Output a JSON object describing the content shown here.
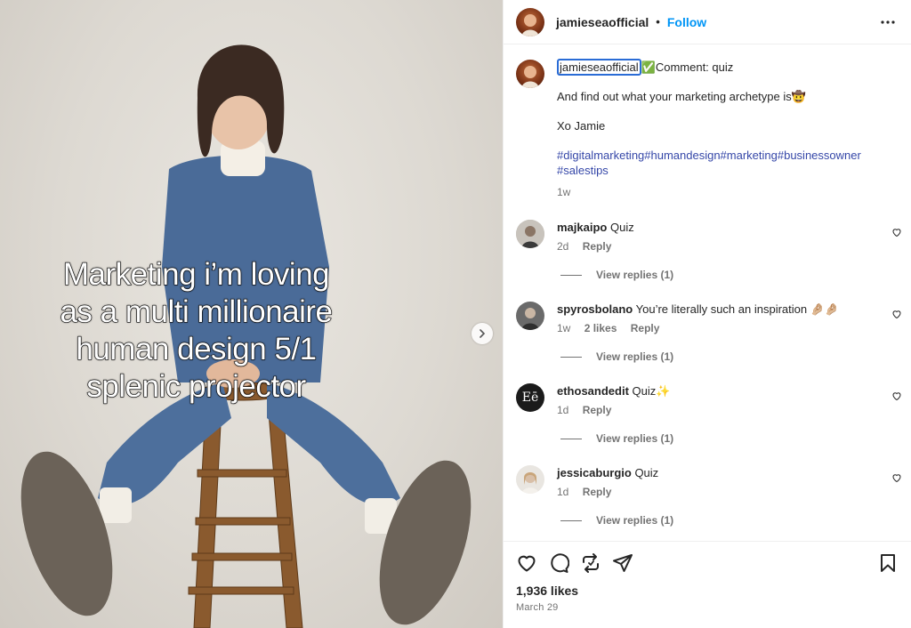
{
  "post": {
    "caption_overlay": [
      "Marketing i’m loving",
      "as a multi millionaire",
      "human design 5/1",
      "splenic projector"
    ]
  },
  "header": {
    "username": "jamieseaofficial",
    "separator": "•",
    "follow_label": "Follow",
    "more_icon": "more-horizontal-icon"
  },
  "caption": {
    "username": "jamieseaofficial",
    "check": "✅",
    "first_line": "Comment: quiz",
    "line2": "And find out what your marketing archetype is🤠",
    "line3": "Xo Jamie",
    "tags_line1": "#digitalmarketing#humandesign#marketing#businessowner",
    "tags_line2": "#salestips",
    "time": "1w"
  },
  "comments": [
    {
      "username": "majkaipo",
      "text": "Quiz",
      "time": "2d",
      "likes": "",
      "reply_label": "Reply",
      "view_replies": "View replies (1)"
    },
    {
      "username": "spyrosbolano",
      "text": "You’re literally such an inspiration 🤌🏼🤌🏼",
      "time": "1w",
      "likes": "2 likes",
      "reply_label": "Reply",
      "view_replies": "View replies (1)"
    },
    {
      "username": "ethosandedit",
      "text": "Quiz✨",
      "time": "1d",
      "likes": "",
      "reply_label": "Reply",
      "view_replies": "View replies (1)",
      "avatar_text": "Eē"
    },
    {
      "username": "jessicaburgio",
      "text": "Quiz",
      "time": "1d",
      "likes": "",
      "reply_label": "Reply",
      "view_replies": "View replies (1)"
    }
  ],
  "footer": {
    "likes": "1,936 likes",
    "date": "March 29",
    "icons": [
      "heart-icon",
      "comment-icon",
      "repost-icon",
      "share-icon",
      "bookmark-icon"
    ]
  },
  "colors": {
    "link": "#0095f6",
    "hashtag": "#3547a8",
    "secondary_text": "#737373",
    "focus_outline": "#2a6cd6"
  }
}
